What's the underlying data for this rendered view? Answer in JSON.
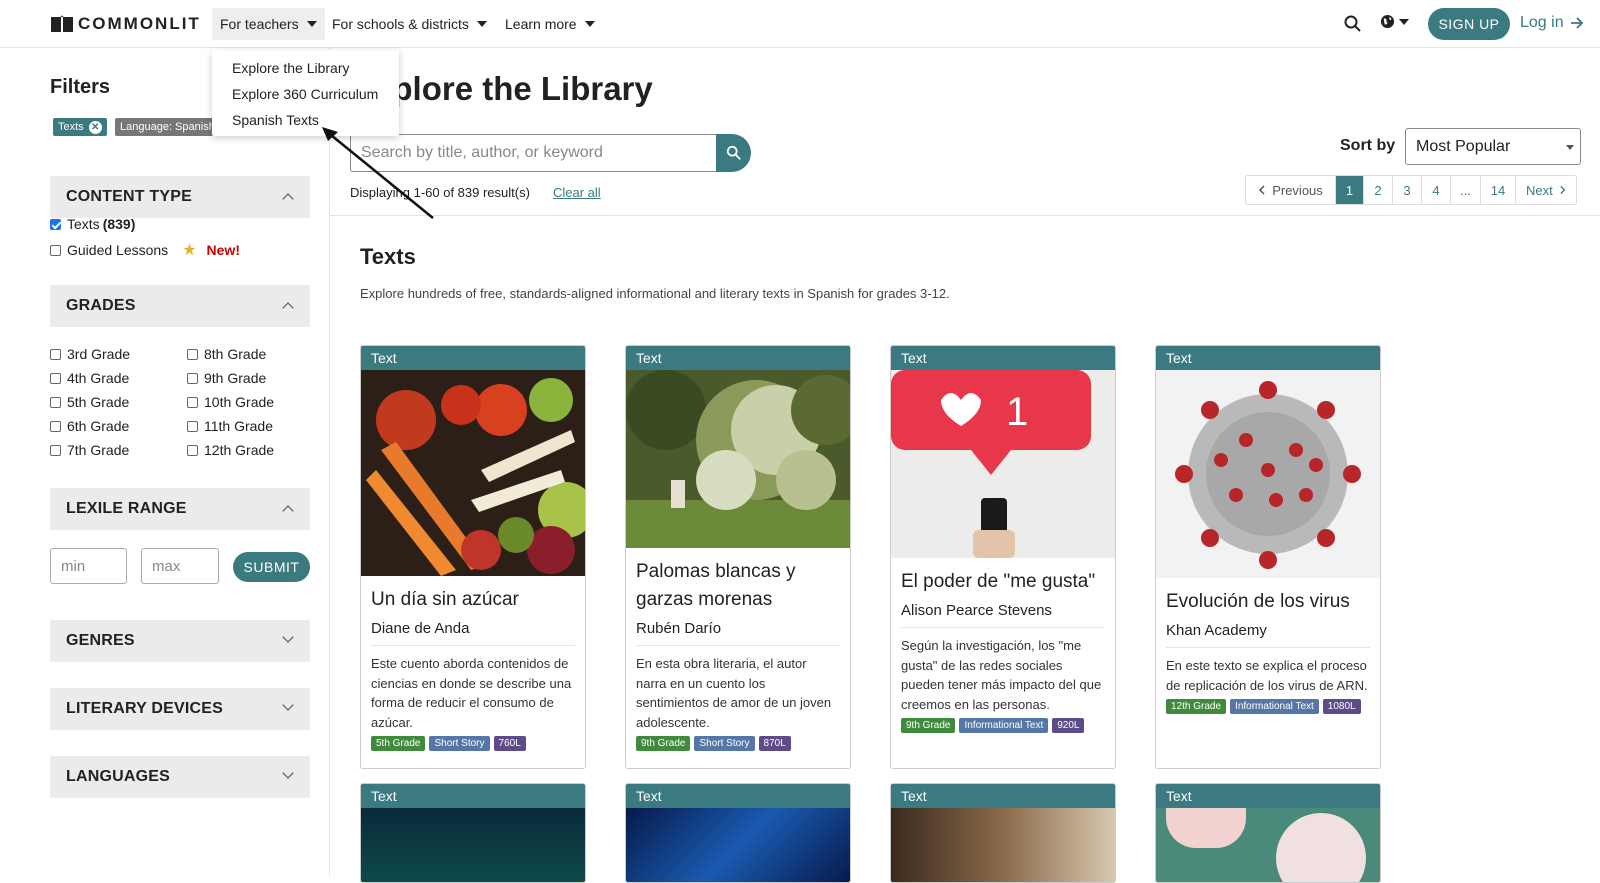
{
  "nav": {
    "logo": "COMMONLIT",
    "items": [
      "For teachers",
      "For schools & districts",
      "Learn more"
    ],
    "signup": "SIGN UP",
    "login": "Log in"
  },
  "dropdown": {
    "items": [
      "Explore the Library",
      "Explore 360 Curriculum",
      "Spanish Texts"
    ]
  },
  "sidebar": {
    "title": "Filters",
    "chips": [
      "Texts",
      "Language: Spanish"
    ],
    "content_type": {
      "heading": "CONTENT TYPE",
      "texts_label": "Texts",
      "texts_count": "(839)",
      "guided_label": "Guided Lessons",
      "new_label": "New!"
    },
    "grades": {
      "heading": "GRADES",
      "items": [
        "3rd Grade",
        "8th Grade",
        "4th Grade",
        "9th Grade",
        "5th Grade",
        "10th Grade",
        "6th Grade",
        "11th Grade",
        "7th Grade",
        "12th Grade"
      ]
    },
    "lexile": {
      "heading": "LEXILE RANGE",
      "min_placeholder": "min",
      "max_placeholder": "max",
      "submit": "SUBMIT"
    },
    "genres": "GENRES",
    "literary_devices": "LITERARY DEVICES",
    "languages": "LANGUAGES"
  },
  "main": {
    "title": "Explore the Library",
    "search_placeholder": "Search by title, author, or keyword",
    "displaying": "Displaying 1-60 of 839 result(s)",
    "clear_all": "Clear all",
    "sort_label": "Sort by",
    "sort_value": "Most Popular",
    "pager": [
      "Previous",
      "1",
      "2",
      "3",
      "4",
      "...",
      "14",
      "Next"
    ],
    "section_title": "Texts",
    "section_desc": "Explore hundreds of free, standards-aligned informational and literary texts in Spanish for grades 3-12."
  },
  "cards": [
    {
      "tag": "Text",
      "title": "Un día sin azúcar",
      "author": "Diane de Anda",
      "desc": "Este cuento aborda contenidos de ciencias en donde se describe una forma de reducir el consumo de azúcar.",
      "grade": "5th Grade",
      "genre": "Short Story",
      "lexile": "760L"
    },
    {
      "tag": "Text",
      "title": "Palomas blancas y garzas morenas",
      "author": "Rubén Darío",
      "desc": "En esta obra literaria, el autor narra en un cuento los sentimientos de amor de un joven adolescente.",
      "grade": "9th Grade",
      "genre": "Short Story",
      "lexile": "870L"
    },
    {
      "tag": "Text",
      "title": "El poder de \"me gusta\"",
      "author": "Alison Pearce Stevens",
      "desc": "Según la investigación, los \"me gusta\" de las redes sociales pueden tener más impacto del que creemos en las personas.",
      "grade": "9th Grade",
      "genre": "Informational Text",
      "lexile": "920L"
    },
    {
      "tag": "Text",
      "title": "Evolución de los virus",
      "author": "Khan Academy",
      "desc": "En este texto se explica el proceso de replicación de los virus de ARN.",
      "grade": "12th Grade",
      "genre": "Informational Text",
      "lexile": "1080L"
    }
  ],
  "cards_row2": [
    "Text",
    "Text",
    "Text",
    "Text"
  ]
}
